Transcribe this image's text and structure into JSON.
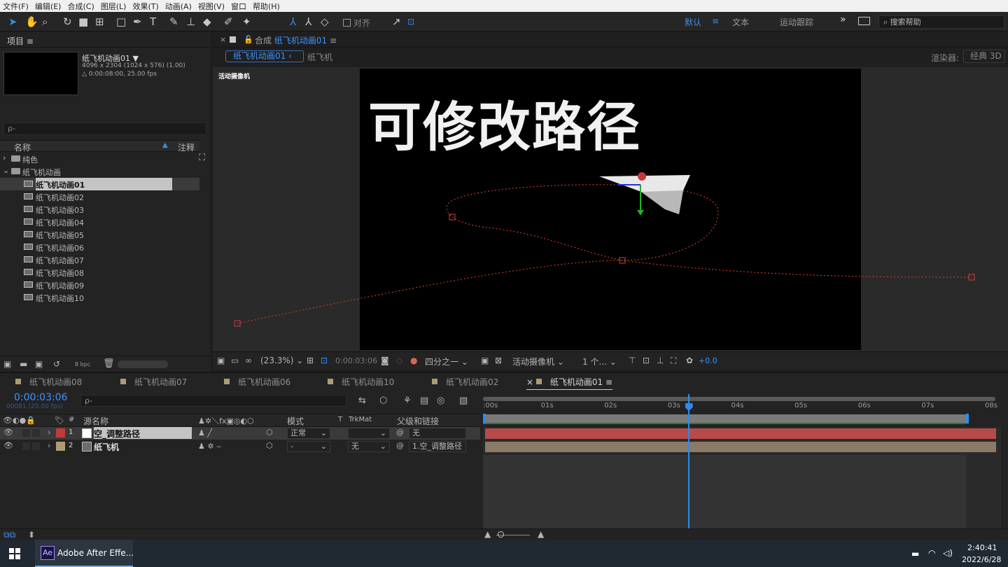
{
  "menu": [
    "文件(F)",
    "编辑(E)",
    "合成(C)",
    "图层(L)",
    "效果(T)",
    "动画(A)",
    "视图(V)",
    "窗口",
    "帮助(H)"
  ],
  "toolbar": {
    "align_label": "对齐",
    "workspaces": [
      "默认",
      "文本",
      "运动跟踪"
    ],
    "more": "»",
    "search_placeholder": "搜索帮助"
  },
  "project": {
    "title": "项目",
    "comp_name": "纸飞机动画01",
    "dims": "4096 x 2304  (1024 x 576) (1.00)",
    "duration": "△ 0:00:08:00, 25.00 fps",
    "search_icon": "ρ-",
    "col_name": "名称",
    "col_comment": "注释",
    "items": [
      {
        "label": "纯色",
        "type": "folder",
        "level": 0,
        "caret": "›"
      },
      {
        "label": "纸飞机动画",
        "type": "folder",
        "level": 0,
        "caret": "⌄"
      },
      {
        "label": "纸飞机动画01",
        "type": "comp",
        "level": 1,
        "selected": true
      },
      {
        "label": "纸飞机动画02",
        "type": "comp",
        "level": 1
      },
      {
        "label": "纸飞机动画03",
        "type": "comp",
        "level": 1
      },
      {
        "label": "纸飞机动画04",
        "type": "comp",
        "level": 1
      },
      {
        "label": "纸飞机动画05",
        "type": "comp",
        "level": 1
      },
      {
        "label": "纸飞机动画06",
        "type": "comp",
        "level": 1
      },
      {
        "label": "纸飞机动画07",
        "type": "comp",
        "level": 1
      },
      {
        "label": "纸飞机动画08",
        "type": "comp",
        "level": 1
      },
      {
        "label": "纸飞机动画09",
        "type": "comp",
        "level": 1
      },
      {
        "label": "纸飞机动画10",
        "type": "comp",
        "level": 1
      }
    ],
    "bpc": "8 bpc"
  },
  "composition": {
    "tab_prefix": "合成",
    "tab_name": "纸飞机动画01",
    "crumb_active": "纸飞机动画01",
    "crumb_next": "纸飞机",
    "renderer_label": "渲染器:",
    "renderer_value": "经典 3D",
    "camera_label": "活动摄像机",
    "overlay_title": "可修改路径",
    "zoom": "(23.3%)",
    "timecode": "0:00:03:06",
    "resolution": "四分之一",
    "view_camera": "活动摄像机",
    "views": "1 个...",
    "exposure": "+0.0"
  },
  "timeline": {
    "tabs": [
      {
        "label": "纸飞机动画08",
        "color": "#b09a75",
        "active": false
      },
      {
        "label": "纸飞机动画07",
        "color": "#b09a75",
        "active": false
      },
      {
        "label": "纸飞机动画06",
        "color": "#b09a75",
        "active": false
      },
      {
        "label": "纸飞机动画10",
        "color": "#b09a75",
        "active": false
      },
      {
        "label": "纸飞机动画02",
        "color": "#b09a75",
        "active": false
      },
      {
        "label": "纸飞机动画01",
        "color": "#b09a75",
        "active": true
      }
    ],
    "current_time": "0:00:03:06",
    "frame_info": "00081 (25.00 fps)",
    "search_icon": "ρ-",
    "columns": {
      "num": "#",
      "name": "源名称",
      "mode": "模式",
      "t": "T",
      "trkmat": "TrkMat",
      "parent": "父级和链接"
    },
    "layers": [
      {
        "num": "1",
        "name": "空_调整路径",
        "label_color": "#c43a3a",
        "mode": "正常",
        "trkmat": "",
        "parent": "无",
        "bar_color": "#b84a4a"
      },
      {
        "num": "2",
        "name": "纸飞机",
        "label_color": "#b09a75",
        "mode": "-",
        "trkmat": "无",
        "parent": "1.空_调整路径",
        "bar_color": "#8a7a66"
      }
    ],
    "ruler_labels": [
      ":00s",
      "01s",
      "02s",
      "03s",
      "04s",
      "05s",
      "06s",
      "07s",
      "08s"
    ],
    "playhead_seconds": 3.24,
    "duration_seconds": 8
  },
  "taskbar": {
    "app_label": "Adobe After Effe...",
    "app_icon": "Ae",
    "time": "2:40:41",
    "date": "2022/6/28"
  }
}
